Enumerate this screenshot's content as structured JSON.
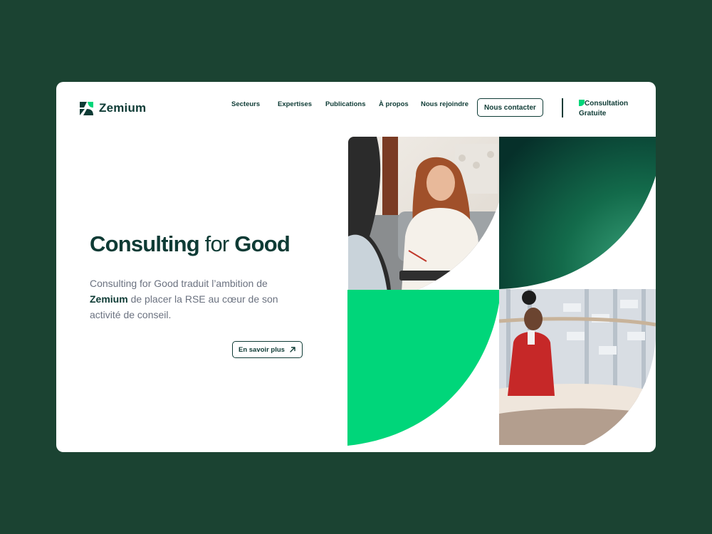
{
  "brand": {
    "name": "Zemium"
  },
  "nav": {
    "items": [
      {
        "label": "Secteurs"
      },
      {
        "label": "Expertises"
      },
      {
        "label": "Publications"
      },
      {
        "label": "À propos"
      },
      {
        "label": "Nous rejoindre"
      }
    ],
    "contact_label": "Nous contacter",
    "consultation_line1": "Consultation",
    "consultation_line2": "Gratuite"
  },
  "hero": {
    "title_part1": "Consulting",
    "title_part2": " for ",
    "title_part3": "Good",
    "desc_part1": "Consulting for Good traduit l’ambition de ",
    "desc_brand": "Zemium",
    "desc_part2": " de placer la RSE au cœur de son activité de conseil.",
    "cta_label": "En savoir plus"
  },
  "colors": {
    "page_background": "#1b4332",
    "brand_dark": "#0e3b35",
    "brand_green": "#00d67a",
    "text_muted": "#6b7280"
  },
  "icons": {
    "logo": "zemium-logo-icon",
    "cta": "arrow-up-right-icon",
    "consultation": "green-leaf-mark-icon"
  }
}
